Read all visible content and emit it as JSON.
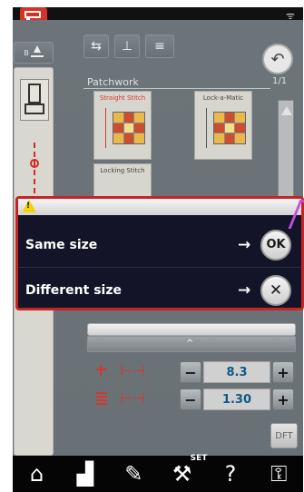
{
  "pattern_list": {
    "title": "Patchwork",
    "page": "1/1",
    "items": [
      {
        "label": "Straight Stitch",
        "selected": true
      },
      {
        "label": "Lock-a-Matic",
        "selected": false
      },
      {
        "label": "Locking Stitch",
        "selected": false
      }
    ]
  },
  "dialog": {
    "warning_icon": "warning-triangle-icon",
    "options": [
      {
        "label": "Same size",
        "arrow": "→",
        "button": "OK"
      },
      {
        "label": "Different size",
        "arrow": "→",
        "button": "✕"
      }
    ]
  },
  "controls": {
    "width_value": "8.3",
    "length_value": "1.30",
    "minus": "−",
    "plus": "+",
    "dft": "DFT",
    "expand_glyph": "^"
  },
  "bottom_nav": {
    "items": [
      "home-icon",
      "machine-icon",
      "pattern-edit-icon",
      "set-wrench-icon",
      "help-icon",
      "lock-key-icon"
    ],
    "set_label": "SET",
    "help_label": "?"
  },
  "colors": {
    "accent_red": "#d6372b",
    "dialog_bg": "#131428",
    "dialog_border": "#c62424",
    "value_text": "#0b5a86"
  }
}
